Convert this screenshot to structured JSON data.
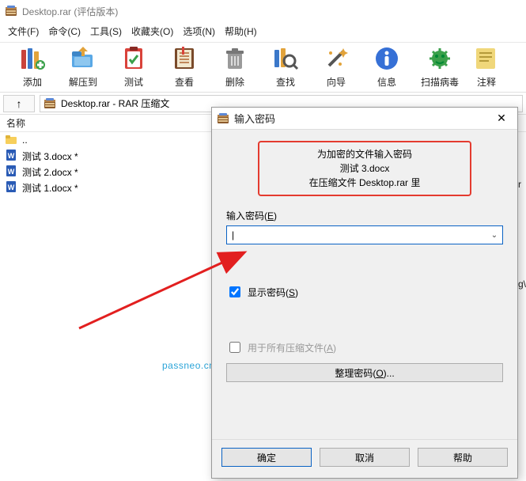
{
  "window": {
    "title": "Desktop.rar (评估版本)"
  },
  "menu": {
    "items": [
      "文件(F)",
      "命令(C)",
      "工具(S)",
      "收藏夹(O)",
      "选项(N)",
      "帮助(H)"
    ]
  },
  "toolbar": {
    "items": [
      {
        "id": "add",
        "label": "添加"
      },
      {
        "id": "extract",
        "label": "解压到"
      },
      {
        "id": "test",
        "label": "测试"
      },
      {
        "id": "view",
        "label": "查看"
      },
      {
        "id": "delete",
        "label": "删除"
      },
      {
        "id": "find",
        "label": "查找"
      },
      {
        "id": "wizard",
        "label": "向导"
      },
      {
        "id": "info",
        "label": "信息"
      },
      {
        "id": "scan",
        "label": "扫描病毒"
      },
      {
        "id": "comment",
        "label": "注释"
      }
    ]
  },
  "navigation": {
    "up_glyph": "↑",
    "address": "Desktop.rar - RAR 压缩文"
  },
  "list": {
    "header_name": "名称",
    "parent": "..",
    "files": [
      "测试 3.docx *",
      "测试 2.docx *",
      "测试 1.docx *"
    ]
  },
  "dialog": {
    "title": "输入密码",
    "prompt_line1": "为加密的文件输入密码",
    "prompt_line2": "测试 3.docx",
    "prompt_line3": "在压缩文件 Desktop.rar 里",
    "field_label_prefix": "输入密码(",
    "field_label_key": "E",
    "field_label_suffix": ")",
    "input_value": "|",
    "show_password_prefix": "显示密码(",
    "show_password_key": "S",
    "show_password_suffix": ")",
    "show_password_checked": true,
    "use_for_all_prefix": "用于所有压缩文件(",
    "use_for_all_key": "A",
    "use_for_all_suffix": ")",
    "use_for_all_checked": false,
    "organize_btn_prefix": "整理密码(",
    "organize_btn_key": "O",
    "organize_btn_suffix": ")...",
    "ok": "确定",
    "cancel": "取消",
    "help": "帮助"
  },
  "watermark": "passneo.cn",
  "right_fragments": [
    "r",
    "g\\"
  ]
}
